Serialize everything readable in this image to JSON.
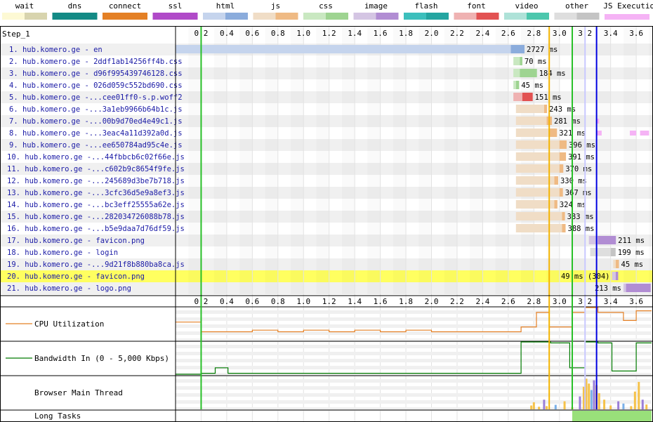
{
  "legend": [
    {
      "label": "wait",
      "color": "#fdf9d4",
      "accent": "#d8d4ae"
    },
    {
      "label": "dns",
      "color": "#138a85",
      "accent": "#138a85"
    },
    {
      "label": "connect",
      "color": "#e48025",
      "accent": "#e48025"
    },
    {
      "label": "ssl",
      "color": "#b04ac8",
      "accent": "#b04ac8"
    },
    {
      "label": "html",
      "color": "#c5d4ed",
      "accent": "#8bacdc"
    },
    {
      "label": "js",
      "color": "#f0ddc6",
      "accent": "#efba84"
    },
    {
      "label": "css",
      "color": "#c9e8c1",
      "accent": "#9ed491"
    },
    {
      "label": "image",
      "color": "#d4c5e3",
      "accent": "#b18dd3"
    },
    {
      "label": "flash",
      "color": "#3cbfbc",
      "accent": "#24a5a1"
    },
    {
      "label": "font",
      "color": "#efb2b2",
      "accent": "#e25252"
    },
    {
      "label": "video",
      "color": "#aee2d8",
      "accent": "#4cc7ad"
    },
    {
      "label": "other",
      "color": "#dedede",
      "accent": "#c4c4c4"
    },
    {
      "label": "JS Execution",
      "color": "#f5b3f5",
      "accent": "#f5b3f5"
    }
  ],
  "step_label": "Step_1",
  "chart_data": {
    "type": "waterfall",
    "x_unit": "seconds",
    "xlim": [
      0,
      3.72
    ],
    "ticks": [
      "0.2",
      "0.4",
      "0.6",
      "0.8",
      "1.0",
      "1.2",
      "1.4",
      "1.6",
      "1.8",
      "2.0",
      "2.2",
      "2.4",
      "2.6",
      "2.8",
      "3.0",
      "3.2",
      "3.4",
      "3.6"
    ],
    "markers": [
      {
        "time": 0.2,
        "color": "#28c028"
      },
      {
        "time": 2.92,
        "color": "#f4b400"
      },
      {
        "time": 3.1,
        "color": "#28c028"
      },
      {
        "time": 3.2,
        "color": "#c8c8ff"
      },
      {
        "time": 3.29,
        "color": "#0000e0"
      }
    ],
    "requests": [
      {
        "label": "1. hub.komero.ge - en",
        "type": "html",
        "start": 0.0,
        "ttfb": 2.62,
        "end": 2.727,
        "duration": "2727 ms",
        "conn": [
          [
            0.0,
            0.085,
            "dns"
          ],
          [
            0.085,
            0.11,
            "connect"
          ],
          [
            0.11,
            0.25,
            "ssl"
          ]
        ]
      },
      {
        "label": "2. hub.komero.ge - 2ddf1ab14256ff4b.css",
        "type": "css",
        "start": 2.64,
        "ttfb": 2.69,
        "end": 2.71,
        "duration": "70 ms"
      },
      {
        "label": "3. hub.komero.ge - d96f995439746128.css",
        "type": "css",
        "start": 2.64,
        "ttfb": 2.69,
        "end": 2.824,
        "duration": "184 ms"
      },
      {
        "label": "4. hub.komero.ge - 026d059c552bd690.css",
        "type": "css",
        "start": 2.64,
        "ttfb": 2.66,
        "end": 2.685,
        "duration": "45 ms"
      },
      {
        "label": "5. hub.komero.ge -...cee01ff0-s.p.woff2",
        "type": "font",
        "start": 2.64,
        "ttfb": 2.71,
        "end": 2.791,
        "duration": "151 ms"
      },
      {
        "label": "6. hub.komero.ge -...3a1eb9966b64b1c.js",
        "type": "js",
        "start": 2.66,
        "ttfb": 2.88,
        "end": 2.903,
        "duration": "243 ms"
      },
      {
        "label": "7. hub.komero.ge -...00b9d70ed4e49c1.js",
        "type": "js",
        "start": 2.66,
        "ttfb": 2.9,
        "end": 2.941,
        "duration": "281 ms"
      },
      {
        "label": "8. hub.komero.ge -...3eac4a11d392a0d.js",
        "type": "js",
        "start": 2.66,
        "ttfb": 2.92,
        "end": 2.981,
        "duration": "321 ms"
      },
      {
        "label": "9. hub.komero.ge -...ee650784ad95c4e.js",
        "type": "js",
        "start": 2.66,
        "ttfb": 3.0,
        "end": 3.056,
        "duration": "396 ms"
      },
      {
        "label": "10. hub.komero.ge -...44fbbcb6c02f66e.js",
        "type": "js",
        "start": 2.66,
        "ttfb": 3.0,
        "end": 3.051,
        "duration": "391 ms"
      },
      {
        "label": "11. hub.komero.ge -...c602b9c8654f9fe.js",
        "type": "js",
        "start": 2.66,
        "ttfb": 3.0,
        "end": 3.03,
        "duration": "370 ms"
      },
      {
        "label": "12. hub.komero.ge -...245689d3be7b718.js",
        "type": "js",
        "start": 2.66,
        "ttfb": 2.96,
        "end": 2.99,
        "duration": "330 ms"
      },
      {
        "label": "13. hub.komero.ge -...3cfc36d5e9a8ef3.js",
        "type": "js",
        "start": 2.66,
        "ttfb": 3.0,
        "end": 3.027,
        "duration": "367 ms"
      },
      {
        "label": "14. hub.komero.ge -...bc3eff25555a62e.js",
        "type": "js",
        "start": 2.66,
        "ttfb": 2.96,
        "end": 2.984,
        "duration": "324 ms"
      },
      {
        "label": "15. hub.komero.ge -...282034726088b78.js",
        "type": "js",
        "start": 2.66,
        "ttfb": 3.02,
        "end": 3.043,
        "duration": "383 ms"
      },
      {
        "label": "16. hub.komero.ge -...b5e9daa7d76df59.js",
        "type": "js",
        "start": 2.66,
        "ttfb": 3.02,
        "end": 3.048,
        "duration": "388 ms"
      },
      {
        "label": "17. hub.komero.ge - favicon.png",
        "type": "image",
        "start": 3.23,
        "ttfb": 3.3,
        "end": 3.441,
        "duration": "211 ms"
      },
      {
        "label": "18. hub.komero.ge - login",
        "type": "other",
        "start": 3.24,
        "ttfb": 3.4,
        "end": 3.439,
        "duration": "199 ms"
      },
      {
        "label": "19. hub.komero.ge -...9d21f8b880ba8ca.js",
        "type": "js",
        "start": 3.42,
        "ttfb": 3.44,
        "end": 3.465,
        "duration": "45 ms"
      },
      {
        "label": "20. hub.komero.ge - favicon.png",
        "type": "image",
        "start": 3.41,
        "ttfb": 3.44,
        "end": 3.459,
        "duration": "49 ms (304)",
        "highlight": true,
        "label_left": true
      },
      {
        "label": "21. hub.komero.ge - logo.png",
        "type": "image",
        "start": 3.5,
        "ttfb": 3.52,
        "end": 3.713,
        "duration": "213 ms",
        "label_left": true
      }
    ],
    "js_execution": [
      {
        "row": 7,
        "spans": [
          [
            3.29,
            3.31
          ]
        ]
      },
      {
        "row": 8,
        "spans": [
          [
            3.29,
            3.33
          ],
          [
            3.55,
            3.6
          ],
          [
            3.63,
            3.7
          ]
        ]
      }
    ],
    "cpu_utilization": [
      [
        0,
        55
      ],
      [
        0.2,
        55
      ],
      [
        0.2,
        40
      ],
      [
        0.2,
        25
      ],
      [
        0.6,
        25
      ],
      [
        0.6,
        30
      ],
      [
        0.8,
        30
      ],
      [
        0.8,
        25
      ],
      [
        1.0,
        25
      ],
      [
        1.0,
        30
      ],
      [
        1.2,
        30
      ],
      [
        1.2,
        25
      ],
      [
        1.4,
        25
      ],
      [
        1.4,
        30
      ],
      [
        1.6,
        30
      ],
      [
        1.6,
        25
      ],
      [
        1.8,
        25
      ],
      [
        1.8,
        30
      ],
      [
        2.0,
        30
      ],
      [
        2.0,
        25
      ],
      [
        2.7,
        25
      ],
      [
        2.7,
        40
      ],
      [
        2.82,
        40
      ],
      [
        2.82,
        85
      ],
      [
        2.92,
        85
      ],
      [
        2.92,
        40
      ],
      [
        3.1,
        40
      ],
      [
        3.1,
        85
      ],
      [
        3.2,
        85
      ],
      [
        3.2,
        100
      ],
      [
        3.3,
        100
      ],
      [
        3.3,
        85
      ],
      [
        3.5,
        85
      ],
      [
        3.5,
        60
      ],
      [
        3.6,
        60
      ],
      [
        3.6,
        90
      ],
      [
        3.72,
        90
      ]
    ],
    "bandwidth_in": [
      [
        0,
        0
      ],
      [
        0.2,
        0
      ],
      [
        0.2,
        3
      ],
      [
        0.31,
        3
      ],
      [
        0.31,
        20
      ],
      [
        0.41,
        20
      ],
      [
        0.41,
        3
      ],
      [
        2.7,
        3
      ],
      [
        2.7,
        100
      ],
      [
        2.93,
        100
      ],
      [
        2.93,
        97
      ],
      [
        3.08,
        97
      ],
      [
        3.08,
        20
      ],
      [
        3.2,
        20
      ],
      [
        3.2,
        100
      ],
      [
        3.3,
        100
      ],
      [
        3.3,
        97
      ],
      [
        3.41,
        97
      ],
      [
        3.41,
        10
      ],
      [
        3.6,
        10
      ],
      [
        3.6,
        97
      ],
      [
        3.72,
        97
      ]
    ],
    "main_thread": [
      [
        2.78,
        12
      ],
      [
        2.8,
        22
      ],
      [
        2.84,
        8
      ],
      [
        2.88,
        30
      ],
      [
        2.9,
        10
      ],
      [
        2.97,
        14
      ],
      [
        3.04,
        25
      ],
      [
        3.1,
        6
      ],
      [
        3.16,
        40
      ],
      [
        3.19,
        70
      ],
      [
        3.21,
        95
      ],
      [
        3.23,
        80
      ],
      [
        3.25,
        60
      ],
      [
        3.27,
        90
      ],
      [
        3.29,
        75
      ],
      [
        3.31,
        50
      ],
      [
        3.35,
        30
      ],
      [
        3.4,
        12
      ],
      [
        3.46,
        25
      ],
      [
        3.5,
        18
      ],
      [
        3.56,
        10
      ],
      [
        3.59,
        55
      ],
      [
        3.62,
        85
      ],
      [
        3.65,
        30
      ],
      [
        3.68,
        15
      ]
    ],
    "long_tasks": [
      [
        3.1,
        3.72
      ]
    ]
  },
  "panels": {
    "cpu_label": "CPU Utilization",
    "bandwidth_label": "Bandwidth In (0 - 5,000 Kbps)",
    "main_thread_label": "Browser Main Thread",
    "long_tasks_label": "Long Tasks"
  },
  "colors": {
    "cpu_line": "#e48025",
    "bandwidth_line": "#007a00",
    "row_stripe": "#f0f0f0",
    "highlight_row": "#ffff60",
    "url_link": "#1a1aa6",
    "long_task": "#99e07a",
    "main_thread_script": "#f5c24a",
    "main_thread_layout": "#9b7fd8",
    "main_thread_paint": "#7ab0e8"
  }
}
